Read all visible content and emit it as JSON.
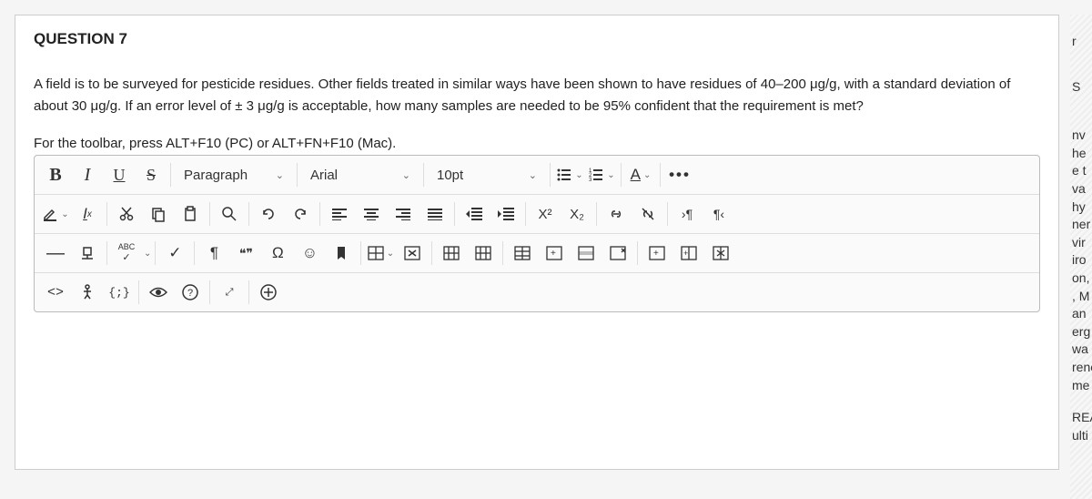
{
  "question": {
    "title": "QUESTION 7",
    "text": "A field is to be surveyed for pesticide residues. Other fields treated in similar ways have been shown to have residues of 40–200 μg/g, with a standard deviation of about 30 μg/g. If an error level of ± 3 μg/g is acceptable, how many samples are needed to be 95% confident that the requirement is met?"
  },
  "editor": {
    "toolbar_hint": "For the toolbar, press ALT+F10 (PC) or ALT+FN+F10 (Mac).",
    "format_style": "Paragraph",
    "font_family": "Arial",
    "font_size": "10pt",
    "bold": "B",
    "italic": "I",
    "underline": "U",
    "strike": "S",
    "clear_format": "Ix",
    "superscript": "X²",
    "subscript": "X₂",
    "ltr": "›¶",
    "rtl": "¶‹",
    "long_dash": "—",
    "checkmark": "✓",
    "pilcrow": "¶",
    "quotes": "❝❞",
    "omega": "Ω",
    "smiley": "☺",
    "spellcheck": "ABC",
    "font_color": "A",
    "more": "•••",
    "code": "<>",
    "curly": "{;}",
    "help": "?",
    "plus": "+"
  },
  "side_fragments": [
    "",
    "r",
    "S",
    "nv",
    "he",
    "e t",
    "va",
    "hy",
    "ner",
    "vir",
    "iro",
    "on,",
    ", M",
    "an",
    "erg",
    "wa",
    "rene",
    "me",
    "",
    "REA",
    "ulti"
  ]
}
